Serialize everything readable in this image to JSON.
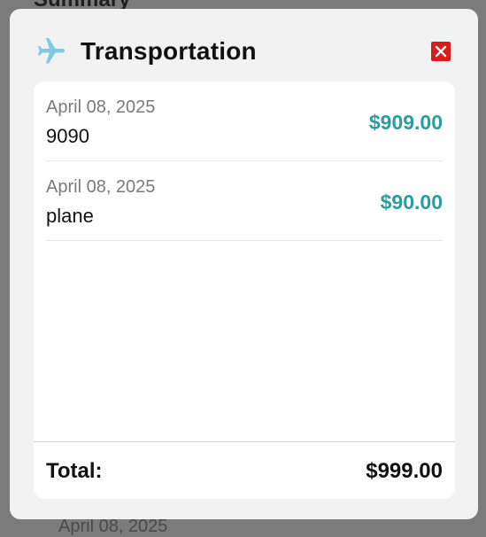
{
  "background": {
    "heading": "Summary",
    "date_peek": "April 08, 2025"
  },
  "modal": {
    "title": "Transportation",
    "icon": "airplane-icon",
    "close_icon": "close-icon",
    "entries": [
      {
        "date": "April 08, 2025",
        "description": "9090",
        "amount": "$909.00"
      },
      {
        "date": "April 08, 2025",
        "description": "plane",
        "amount": "$90.00"
      }
    ],
    "total_label": "Total:",
    "total_value": "$999.00"
  },
  "colors": {
    "overlay": "#7b7b7b",
    "accent_amount": "#2a9d9f",
    "icon_plane": "#7ecbe6",
    "close": "#dd1a1a"
  }
}
